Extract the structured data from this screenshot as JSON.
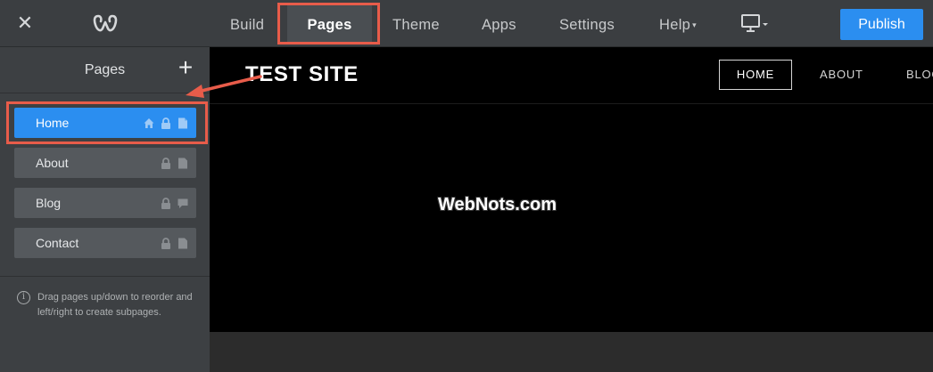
{
  "topbar": {
    "close_icon": "close-icon",
    "logo_icon": "weebly-logo-icon",
    "nav": {
      "build": "Build",
      "pages": "Pages",
      "theme": "Theme",
      "apps": "Apps",
      "settings": "Settings",
      "help": "Help"
    },
    "device_icon": "desktop-icon",
    "publish_label": "Publish",
    "accent": "#2b8ef0",
    "highlight_color": "#e85c4a"
  },
  "sidebar": {
    "title": "Pages",
    "add_icon": "plus-icon",
    "pages": [
      {
        "label": "Home",
        "icons": [
          "home-icon",
          "lock-icon",
          "page-icon"
        ],
        "active": true
      },
      {
        "label": "About",
        "icons": [
          "lock-icon",
          "page-icon"
        ],
        "active": false
      },
      {
        "label": "Blog",
        "icons": [
          "lock-icon",
          "comment-icon"
        ],
        "active": false
      },
      {
        "label": "Contact",
        "icons": [
          "lock-icon",
          "page-icon"
        ],
        "active": false
      }
    ],
    "hint": "Drag pages up/down to reorder and left/right to create subpages."
  },
  "site": {
    "title": "TEST SITE",
    "nav": [
      "HOME",
      "ABOUT",
      "BLOG"
    ],
    "watermark": "WebNots.com"
  }
}
